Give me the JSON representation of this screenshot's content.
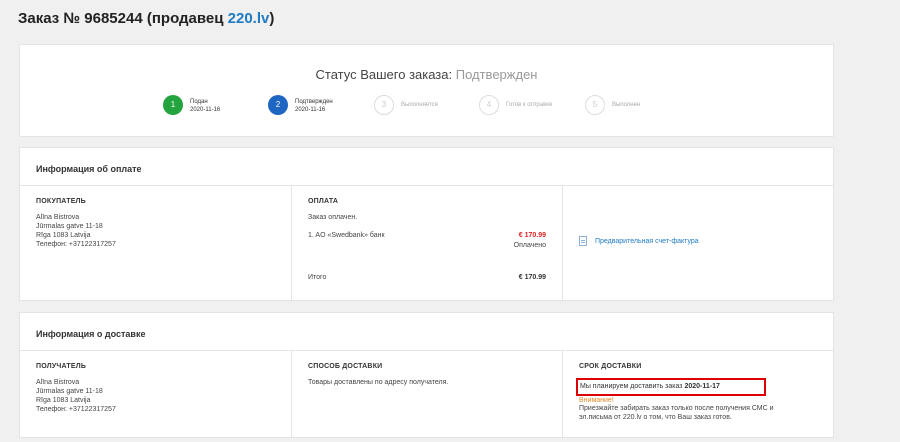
{
  "page": {
    "title_prefix": "Заказ № 9685244 (продавец ",
    "seller": "220.lv",
    "title_suffix": ")"
  },
  "status": {
    "label": "Статус Вашего заказа: ",
    "value": "Подтвержден",
    "steps": [
      {
        "number": "1",
        "name": "Подан",
        "date": "2020-11-16"
      },
      {
        "number": "2",
        "name": "Подтвержден",
        "date": "2020-11-16"
      },
      {
        "number": "3",
        "name": "Выполняется"
      },
      {
        "number": "4",
        "name": "Готов к отправке"
      },
      {
        "number": "5",
        "name": "Выполнен"
      }
    ]
  },
  "payment_info": {
    "header": "Информация об оплате",
    "buyer": {
      "title": "ПОКУПАТЕЛЬ",
      "name": "Alīna Bistrova",
      "street": "Jūrmalas gatve 11-18",
      "city": "Rīga 1083 Latvija",
      "phone": "Телефон: +37122317257"
    },
    "payment": {
      "title": "ОПЛАТА",
      "status": "Заказ оплачен.",
      "method": "1. AO «Swedbank» банк",
      "amount": "€ 170.99",
      "amount_status": "Оплачено",
      "total_label": "Итого",
      "total_value": "€ 170.99"
    },
    "invoice_link": "Предварительная счет-фактура"
  },
  "delivery_info": {
    "header": "Информация о доставке",
    "recipient": {
      "title": "ПОЛУЧАТЕЛЬ",
      "name": "Alīna Bistrova",
      "street": "Jūrmalas gatve 11-18",
      "city": "Rīga 1083 Latvija",
      "phone": "Телефон: +37122317257"
    },
    "method": {
      "title": "СПОСОБ ДОСТАВКИ",
      "text": "Товары доставлены по адресу получателя."
    },
    "term": {
      "title": "СРОК ДОСТАВКИ",
      "planned_text": "Мы планируем доставить заказ ",
      "planned_date": "2020-11-17",
      "attention": "Внимание!",
      "note_line1": "Приезжайте забирать заказ только после получения СМС и",
      "note_line2": "эл.письма от 220.lv о том, что Ваш заказ готов."
    }
  },
  "colors": {
    "step_done": "#23a43e",
    "step_current": "#1e66c2",
    "link": "#1e7bc4",
    "amount": "#dd2222",
    "highlight": "#dd0000",
    "attention": "#e38b2c"
  }
}
